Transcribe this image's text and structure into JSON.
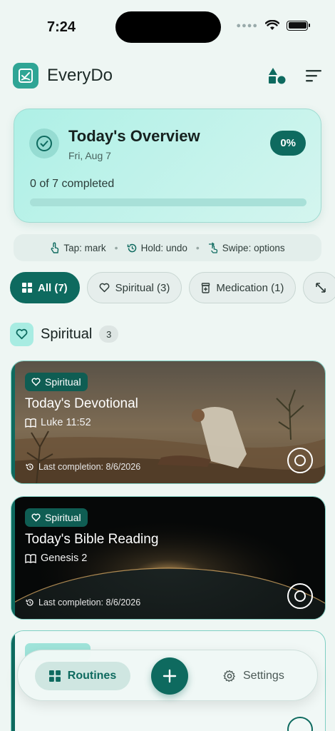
{
  "status_bar": {
    "time": "7:24"
  },
  "app": {
    "title": "EveryDo"
  },
  "overview": {
    "title": "Today's Overview",
    "date": "Fri, Aug 7",
    "percent_label": "0%",
    "progress_text": "0 of 7 completed",
    "progress_fraction": 0
  },
  "hints": [
    {
      "icon": "tap-icon",
      "label": "Tap: mark"
    },
    {
      "icon": "undo-history-icon",
      "label": "Hold: undo"
    },
    {
      "icon": "swipe-icon",
      "label": "Swipe: options"
    }
  ],
  "filters": [
    {
      "icon": "grid-icon",
      "label": "All (7)",
      "active": true
    },
    {
      "icon": "heart-icon",
      "label": "Spiritual (3)",
      "active": false
    },
    {
      "icon": "medication-icon",
      "label": "Medication (1)",
      "active": false
    }
  ],
  "section": {
    "title": "Spiritual",
    "count": "3"
  },
  "routines": [
    {
      "tag": "Spiritual",
      "title": "Today's Devotional",
      "reference": "Luke 11:52",
      "last": "Last completion: 8/6/2026"
    },
    {
      "tag": "Spiritual",
      "title": "Today's Bible Reading",
      "reference": "Genesis 2",
      "last": "Last completion: 8/6/2026"
    }
  ],
  "bottom_nav": {
    "routines": "Routines",
    "settings": "Settings"
  },
  "colors": {
    "primary": "#0e6a5f",
    "accent": "#2fa595",
    "background": "#eef6f3"
  }
}
